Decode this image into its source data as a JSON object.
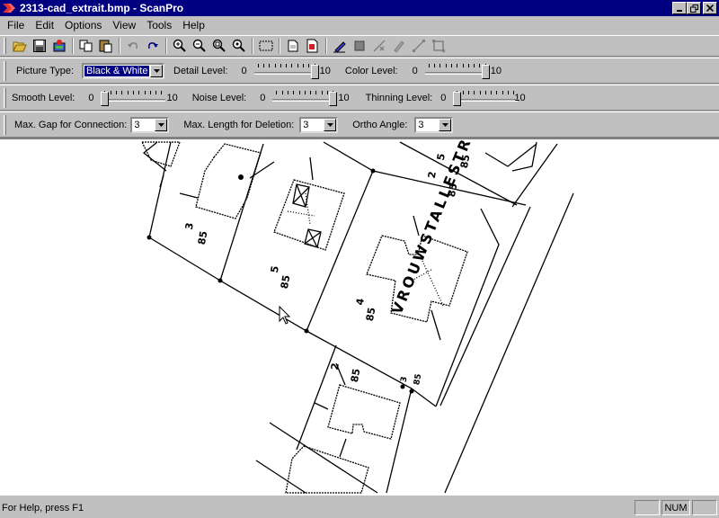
{
  "window": {
    "title": "2313-cad_extrait.bmp - ScanPro",
    "controls": [
      "minimize",
      "maximize",
      "close"
    ]
  },
  "menu": [
    "File",
    "Edit",
    "Options",
    "View",
    "Tools",
    "Help"
  ],
  "toolbar_icons": [
    "open-icon",
    "save-icon",
    "scan-icon",
    "copy-icon",
    "paste-icon",
    "undo-icon",
    "redo-icon",
    "zoom-in-icon",
    "zoom-out-icon",
    "zoom-fit-icon",
    "zoom-window-icon",
    "select-rect-icon",
    "page-icon",
    "page-settings-icon",
    "pen-icon",
    "fill-icon",
    "erase-line-icon",
    "pencil-icon",
    "line-icon",
    "rect-icon"
  ],
  "params": {
    "picture_type_label": "Picture Type:",
    "picture_type_value": "Black & White",
    "detail_label": "Detail Level:",
    "detail_min": "0",
    "detail_max": "10",
    "detail_value": 10,
    "color_label": "Color Level:",
    "color_min": "0",
    "color_max": "10",
    "color_value": 10,
    "smooth_label": "Smooth Level:",
    "smooth_min": "0",
    "smooth_max": "10",
    "smooth_value": 0,
    "noise_label": "Noise Level:",
    "noise_min": "0",
    "noise_max": "10",
    "noise_value": 10,
    "thinning_label": "Thinning Level:",
    "thinning_min": "0",
    "thinning_max": "10",
    "thinning_value": 0,
    "max_gap_label": "Max. Gap for Connection:",
    "max_gap_value": "3",
    "max_length_label": "Max. Length for Deletion:",
    "max_length_value": "3",
    "ortho_label": "Ortho Angle:",
    "ortho_value": "3"
  },
  "map": {
    "street_name": "VROUWSTALLESTRAAT",
    "parcel_labels": [
      "3",
      "85",
      "5",
      "85",
      "4",
      "85",
      "2",
      "85",
      "2",
      "85",
      "5",
      "85",
      "3",
      "85"
    ]
  },
  "status": {
    "help_text": "For Help, press F1",
    "num_indicator": "NUM"
  }
}
